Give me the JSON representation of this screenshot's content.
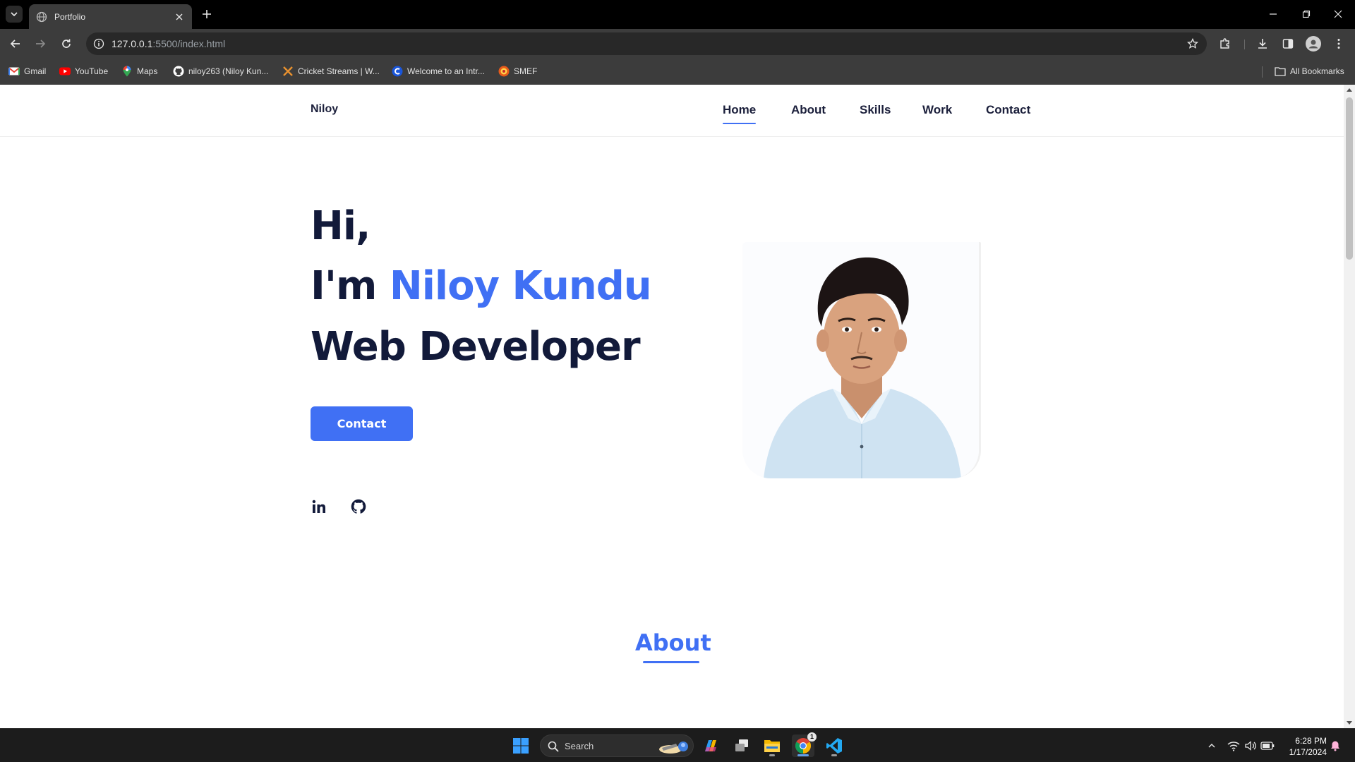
{
  "browser": {
    "tab": {
      "title": "Portfolio"
    },
    "url": {
      "host": "127.0.0.1",
      "rest": ":5500/index.html"
    },
    "bookmarks": [
      {
        "label": "Gmail",
        "icon": "gmail-icon"
      },
      {
        "label": "YouTube",
        "icon": "youtube-icon"
      },
      {
        "label": "Maps",
        "icon": "maps-icon"
      },
      {
        "label": "niloy263 (Niloy Kun...",
        "icon": "github-icon"
      },
      {
        "label": "Cricket Streams | W...",
        "icon": "cricket-icon"
      },
      {
        "label": "Welcome to an Intr...",
        "icon": "c-logo-icon"
      },
      {
        "label": "SMEF",
        "icon": "smef-icon"
      }
    ],
    "all_bookmarks": "All Bookmarks"
  },
  "site": {
    "logo": "Niloy",
    "nav": [
      {
        "label": "Home",
        "active": true
      },
      {
        "label": "About",
        "active": false
      },
      {
        "label": "Skills",
        "active": false
      },
      {
        "label": "Work",
        "active": false
      },
      {
        "label": "Contact",
        "active": false
      }
    ],
    "hero": {
      "line1": "Hi,",
      "line2_prefix": "I'm ",
      "line2_name": "Niloy Kundu",
      "line3": "Web Developer",
      "button": "Contact"
    },
    "social": [
      "linkedin-icon",
      "github-icon"
    ],
    "about_title": "About"
  },
  "taskbar": {
    "search_label": "Search",
    "time": "6:28 PM",
    "date": "1/17/2024",
    "chrome_badge": "1"
  },
  "colors": {
    "accent": "#4070f4",
    "heading": "#121a3a",
    "chrome_bg": "#3c3c3c"
  }
}
